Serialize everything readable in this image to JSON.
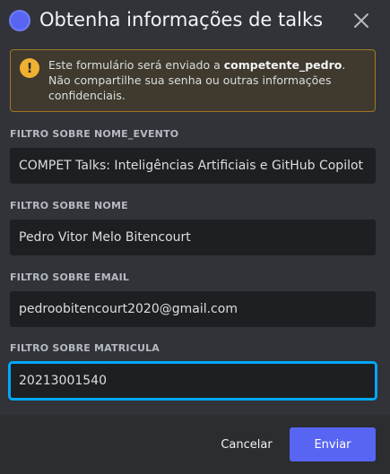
{
  "modal": {
    "title": "Obtenha informações de talks",
    "close_icon": "close-icon",
    "avatar_icon": "app-avatar-icon"
  },
  "warning": {
    "icon": "warning-icon",
    "icon_glyph": "!",
    "text_before": "Este formulário será enviado a ",
    "recipient": "competente_pedro",
    "text_after": ". Não compartilhe sua senha ou outras informações confidenciais."
  },
  "fields": [
    {
      "label": "FILTRO SOBRE NOME_EVENTO",
      "value": "COMPET Talks: Inteligências Artificiais e GitHub Copilot"
    },
    {
      "label": "FILTRO SOBRE NOME",
      "value": "Pedro Vitor Melo Bitencourt"
    },
    {
      "label": "FILTRO SOBRE EMAIL",
      "value": "pedroobitencourt2020@gmail.com"
    },
    {
      "label": "FILTRO SOBRE MATRICULA",
      "value": "20213001540"
    }
  ],
  "footer": {
    "cancel_label": "Cancelar",
    "submit_label": "Enviar"
  },
  "colors": {
    "background": "#313338",
    "footer": "#2b2d31",
    "input": "#1e1f22",
    "accent": "#5865f2",
    "focus": "#00a8fc",
    "warning_border": "#a17724",
    "warning_icon": "#f0b132"
  }
}
